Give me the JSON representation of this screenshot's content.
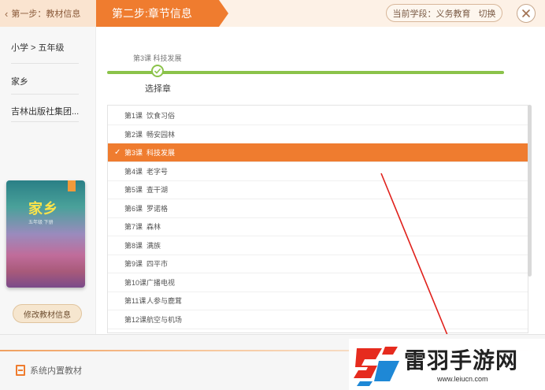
{
  "header": {
    "step1_label": "第一步：教材信息",
    "step2_label": "第二步:章节信息",
    "stage_label": "当前学段：义务教育",
    "switch_label": "切换"
  },
  "sidebar": {
    "items": [
      {
        "label": "小学 > 五年级"
      },
      {
        "label": "家乡"
      },
      {
        "label": "吉林出版社集团..."
      }
    ],
    "book_cover": {
      "title": "家乡",
      "subtitle": "五年级 下册"
    },
    "edit_button": "修改教材信息"
  },
  "main": {
    "breadcrumb": "第3课  科技发展",
    "progress_label": "选择章",
    "lessons": [
      {
        "num": "第1课",
        "name": "饮食习俗",
        "selected": false
      },
      {
        "num": "第2课",
        "name": "畅安园林",
        "selected": false
      },
      {
        "num": "第3课",
        "name": "科技发展",
        "selected": true
      },
      {
        "num": "第4课",
        "name": "老字号",
        "selected": false
      },
      {
        "num": "第5课",
        "name": "查干湖",
        "selected": false
      },
      {
        "num": "第6课",
        "name": "罗诺格",
        "selected": false
      },
      {
        "num": "第7课",
        "name": "森林",
        "selected": false
      },
      {
        "num": "第8课",
        "name": "满族",
        "selected": false
      },
      {
        "num": "第9课",
        "name": "四平市",
        "selected": false
      },
      {
        "num": "第10课",
        "name": "广播电视",
        "selected": false
      },
      {
        "num": "第11课",
        "name": "人参与鹿茸",
        "selected": false
      },
      {
        "num": "第12课",
        "name": "航空与机场",
        "selected": false
      }
    ]
  },
  "footer": {
    "builtin_label": "系统内置教材"
  },
  "watermark": {
    "brand": "雷羽手游网",
    "url": "www.leiucn.com"
  },
  "colors": {
    "accent": "#ef7c2f",
    "progress": "#8bc34a",
    "annotation": "#e0201b"
  }
}
